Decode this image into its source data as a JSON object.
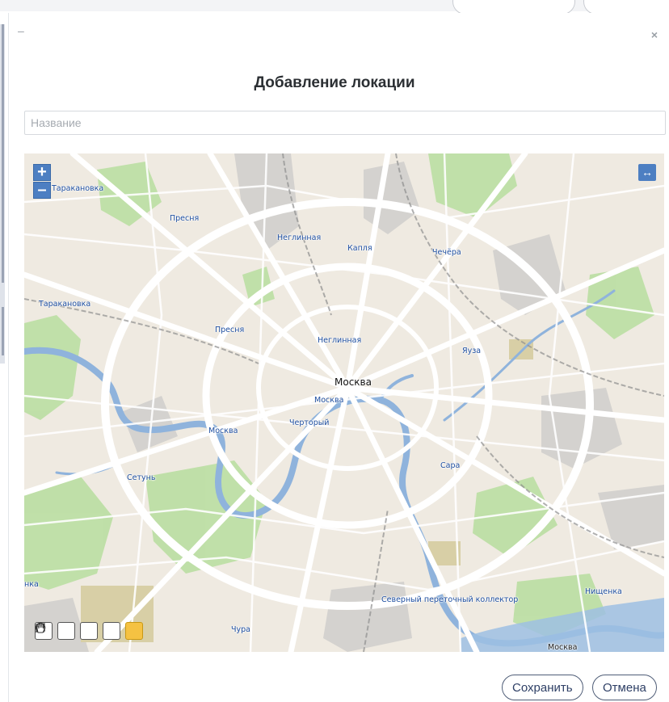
{
  "modal": {
    "minimize_label": "–",
    "close_label": "×",
    "title": "Добавление локации"
  },
  "form": {
    "name_placeholder": "Название",
    "name_value": ""
  },
  "map": {
    "zoom_in": "+",
    "zoom_out": "–",
    "expand": "↔",
    "labels": {
      "tarakanovka_top": "Таракановка",
      "presnya_top": "Пресня",
      "neglinnaya_top": "Неглинная",
      "kaplya": "Капля",
      "chechera": "Чечёра",
      "tarakanovka_mid": "Таракановка",
      "presnya_mid": "Пресня",
      "neglinnaya_mid": "Неглинная",
      "yauza": "Яуза",
      "moskva_city": "Москва",
      "moskva_river_center": "Москва",
      "chertory": "Черторый",
      "moskva_river_left": "Москва",
      "setun": "Сетунь",
      "sara": "Сара",
      "nka": "нка",
      "severny": "Северный переточный коллектор",
      "nishchenka": "Нищенка",
      "chura": "Чура",
      "moskva_bottom": "Москва"
    },
    "tools": [
      "circle-tool",
      "polygon-tool",
      "polyline-tool",
      "edit-tool",
      "pan-tool"
    ],
    "active_tool": "pan-tool"
  },
  "actions": {
    "save": "Сохранить",
    "cancel": "Отмена"
  },
  "colors": {
    "accent": "#4d7fc2",
    "active_tool": "#f5c242",
    "river": "#7fa8d8",
    "park": "#b9dea0"
  }
}
